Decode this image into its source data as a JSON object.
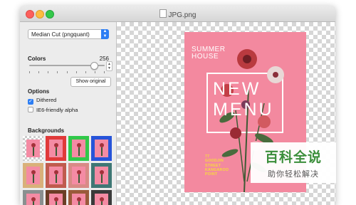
{
  "window": {
    "title": "JPG.png"
  },
  "sidebar": {
    "algorithm_select": {
      "value": "Median Cut (pngquant)"
    },
    "colors": {
      "label": "Colors",
      "value": "256",
      "slider_fraction": 0.86
    },
    "show_original_label": "Show original",
    "options": {
      "label": "Options",
      "dithered": {
        "label": "Dithered",
        "checked": true
      },
      "ie6": {
        "label": "IE6-friendly alpha",
        "checked": false
      }
    },
    "backgrounds": {
      "label": "Backgrounds",
      "swatches": [
        {
          "kind": "checker"
        },
        {
          "color": "#e03a3a"
        },
        {
          "color": "#31c84a"
        },
        {
          "color": "#2754d9"
        },
        {
          "color": "#d9b07a"
        },
        {
          "color": "#c05b4e"
        },
        {
          "color": "#d88a86"
        },
        {
          "color": "#3f7775"
        },
        {
          "color": "#8a8f8f"
        },
        {
          "color": "#6b3e26"
        },
        {
          "color": "#9a5a3a"
        },
        {
          "color": "#3a3a3a"
        }
      ]
    }
  },
  "poster": {
    "summer_line1": "SUMMER",
    "summer_line2": "HOUSE",
    "headline_line1": "NEW",
    "headline_line2": "MENU",
    "address": [
      "77",
      "GOODJIN",
      "STREET",
      "KANGAROO",
      "POINT"
    ],
    "bg_color": "#f3899f",
    "accent_color": "#f7dc3a"
  },
  "watermark": {
    "main": "百科全说",
    "sub": "助你轻松解决"
  }
}
